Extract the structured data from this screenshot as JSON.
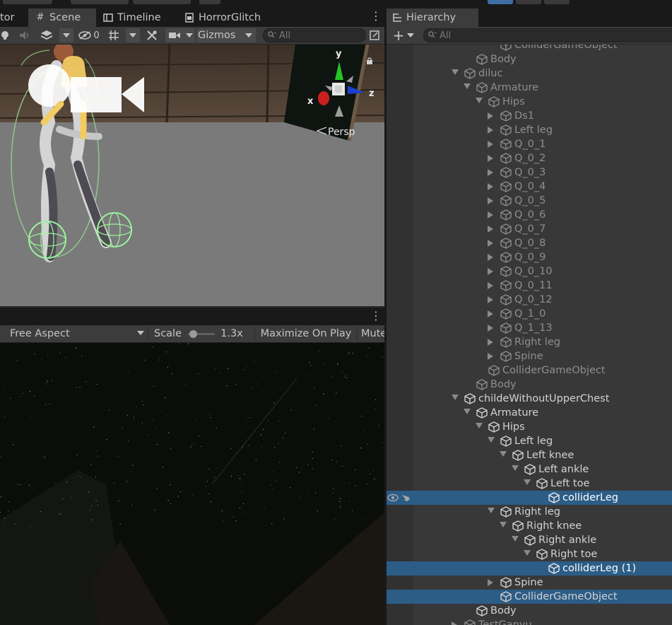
{
  "scene_tabs": [
    {
      "label": "tor",
      "icon": "none",
      "active": false
    },
    {
      "label": "Scene",
      "icon": "#",
      "active": true
    },
    {
      "label": "Timeline",
      "icon": "timeline-icon",
      "active": false
    },
    {
      "label": "HorrorGlitch",
      "icon": "script-icon",
      "active": false
    }
  ],
  "scene_toolbar": {
    "hidden_count": "0",
    "gizmos_label": "Gizmos",
    "search_placeholder": "All"
  },
  "scene_view": {
    "gizmo_x": "x",
    "gizmo_y": "y",
    "gizmo_z": "z",
    "projection_label": "Persp"
  },
  "game_toolbar": {
    "aspect_label": "Free Aspect",
    "scale_label": "Scale",
    "scale_value": "1.3x",
    "scale_fraction": 0.05,
    "maximize_label": "Maximize On Play",
    "mute_label": "Mute"
  },
  "hierarchy": {
    "title": "Hierarchy",
    "search_placeholder": "All",
    "rows": [
      {
        "label": "ColliderGameObject",
        "depth": 5,
        "expand": "none",
        "style": "dim",
        "selected": false
      },
      {
        "label": "Body",
        "depth": 3,
        "expand": "none",
        "style": "dim",
        "selected": false
      },
      {
        "label": "diluc",
        "depth": 2,
        "expand": "open",
        "style": "dim",
        "selected": false
      },
      {
        "label": "Armature",
        "depth": 3,
        "expand": "open",
        "style": "dim",
        "selected": false
      },
      {
        "label": "Hips",
        "depth": 4,
        "expand": "open",
        "style": "dim",
        "selected": false
      },
      {
        "label": "Ds1",
        "depth": 5,
        "expand": "closed",
        "style": "dim",
        "selected": false
      },
      {
        "label": "Left leg",
        "depth": 5,
        "expand": "closed",
        "style": "dim",
        "selected": false
      },
      {
        "label": "Q_0_1",
        "depth": 5,
        "expand": "closed",
        "style": "dim",
        "selected": false
      },
      {
        "label": "Q_0_2",
        "depth": 5,
        "expand": "closed",
        "style": "dim",
        "selected": false
      },
      {
        "label": "Q_0_3",
        "depth": 5,
        "expand": "closed",
        "style": "dim",
        "selected": false
      },
      {
        "label": "Q_0_4",
        "depth": 5,
        "expand": "closed",
        "style": "dim",
        "selected": false
      },
      {
        "label": "Q_0_5",
        "depth": 5,
        "expand": "closed",
        "style": "dim",
        "selected": false
      },
      {
        "label": "Q_0_6",
        "depth": 5,
        "expand": "closed",
        "style": "dim",
        "selected": false
      },
      {
        "label": "Q_0_7",
        "depth": 5,
        "expand": "closed",
        "style": "dim",
        "selected": false
      },
      {
        "label": "Q_0_8",
        "depth": 5,
        "expand": "closed",
        "style": "dim",
        "selected": false
      },
      {
        "label": "Q_0_9",
        "depth": 5,
        "expand": "closed",
        "style": "dim",
        "selected": false
      },
      {
        "label": "Q_0_10",
        "depth": 5,
        "expand": "closed",
        "style": "dim",
        "selected": false
      },
      {
        "label": "Q_0_11",
        "depth": 5,
        "expand": "closed",
        "style": "dim",
        "selected": false
      },
      {
        "label": "Q_0_12",
        "depth": 5,
        "expand": "closed",
        "style": "dim",
        "selected": false
      },
      {
        "label": "Q_1_0",
        "depth": 5,
        "expand": "closed",
        "style": "dim",
        "selected": false
      },
      {
        "label": "Q_1_13",
        "depth": 5,
        "expand": "closed",
        "style": "dim",
        "selected": false
      },
      {
        "label": "Right leg",
        "depth": 5,
        "expand": "closed",
        "style": "dim",
        "selected": false
      },
      {
        "label": "Spine",
        "depth": 5,
        "expand": "closed",
        "style": "dim",
        "selected": false
      },
      {
        "label": "ColliderGameObject",
        "depth": 4,
        "expand": "none",
        "style": "dim",
        "selected": false
      },
      {
        "label": "Body",
        "depth": 3,
        "expand": "none",
        "style": "dim",
        "selected": false
      },
      {
        "label": "childeWithoutUpperChest",
        "depth": 2,
        "expand": "open",
        "style": "normal",
        "selected": false
      },
      {
        "label": "Armature",
        "depth": 3,
        "expand": "open",
        "style": "normal",
        "selected": false
      },
      {
        "label": "Hips",
        "depth": 4,
        "expand": "open",
        "style": "normal",
        "selected": false
      },
      {
        "label": "Left leg",
        "depth": 5,
        "expand": "open",
        "style": "normal",
        "selected": false
      },
      {
        "label": "Left knee",
        "depth": 6,
        "expand": "open",
        "style": "normal",
        "selected": false
      },
      {
        "label": "Left ankle",
        "depth": 7,
        "expand": "open",
        "style": "normal",
        "selected": false
      },
      {
        "label": "Left toe",
        "depth": 8,
        "expand": "open",
        "style": "normal",
        "selected": false
      },
      {
        "label": "colliderLeg",
        "depth": 9,
        "expand": "none",
        "style": "sel-text",
        "selected": true
      },
      {
        "label": "Right leg",
        "depth": 5,
        "expand": "open",
        "style": "normal",
        "selected": false
      },
      {
        "label": "Right knee",
        "depth": 6,
        "expand": "open",
        "style": "normal",
        "selected": false
      },
      {
        "label": "Right ankle",
        "depth": 7,
        "expand": "open",
        "style": "normal",
        "selected": false
      },
      {
        "label": "Right toe",
        "depth": 8,
        "expand": "open",
        "style": "normal",
        "selected": false
      },
      {
        "label": "colliderLeg (1)",
        "depth": 9,
        "expand": "none",
        "style": "sel-text",
        "selected": true
      },
      {
        "label": "Spine",
        "depth": 5,
        "expand": "closed",
        "style": "normal",
        "selected": false
      },
      {
        "label": "ColliderGameObject",
        "depth": 5,
        "expand": "none",
        "style": "normal",
        "selected": true
      },
      {
        "label": "Body",
        "depth": 3,
        "expand": "none",
        "style": "normal",
        "selected": false
      },
      {
        "label": "TestGanyu",
        "depth": 2,
        "expand": "closed",
        "style": "dim",
        "selected": false
      }
    ]
  },
  "colors": {
    "selection": "#2c5d87",
    "panel_bg": "#383838",
    "toolbar_bg": "#3c3c3c",
    "gizmo_x": "#c9201e",
    "gizmo_y": "#27c327",
    "gizmo_z": "#1c3fd0"
  }
}
